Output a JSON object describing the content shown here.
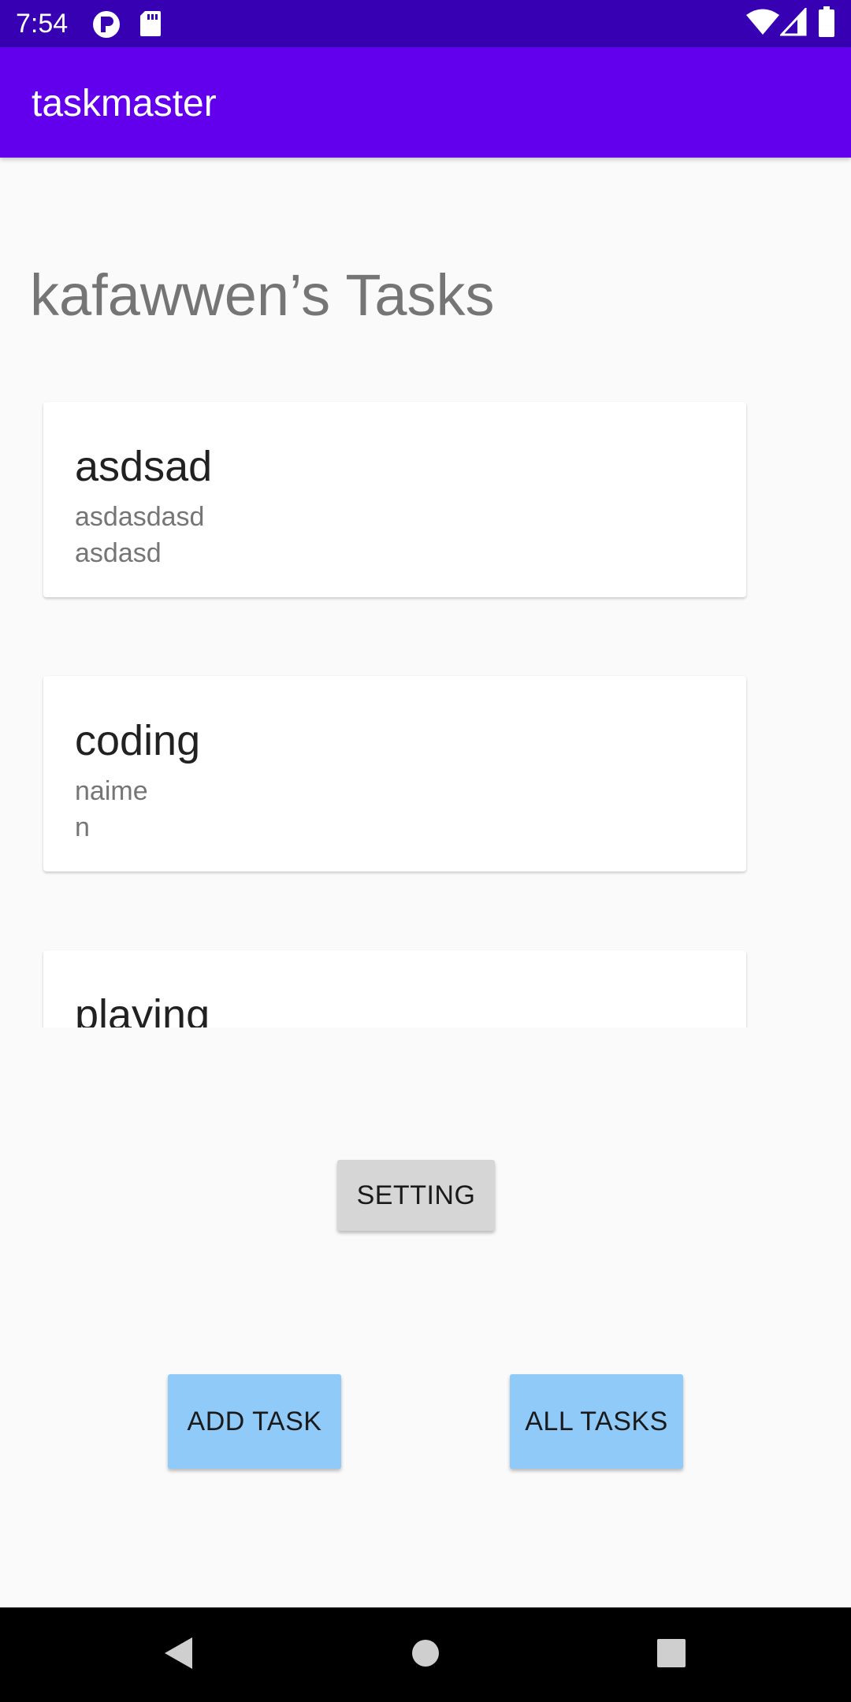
{
  "status_bar": {
    "time": "7:54"
  },
  "app_bar": {
    "title": "taskmaster"
  },
  "main": {
    "heading": "kafawwen’s Tasks",
    "tasks": [
      {
        "title": "asdsad",
        "body": "asdasdasd",
        "state": "asdasd"
      },
      {
        "title": "coding",
        "body": "naime",
        "state": "n"
      },
      {
        "title": "playing"
      }
    ],
    "setting_button": "SETTING",
    "add_task_button": "ADD TASK",
    "all_tasks_button": "ALL TASKS"
  },
  "colors": {
    "status_bar": "#3700b3",
    "app_bar": "#6200ee",
    "background": "#fafafa",
    "blue_button": "#90caf9",
    "grey_button": "#d6d6d6"
  },
  "icons": {
    "status": [
      "p-icon",
      "sd-card-icon",
      "wifi-icon",
      "signal-icon",
      "battery-icon"
    ],
    "navigation": [
      "back-icon",
      "home-icon",
      "recents-icon"
    ]
  }
}
